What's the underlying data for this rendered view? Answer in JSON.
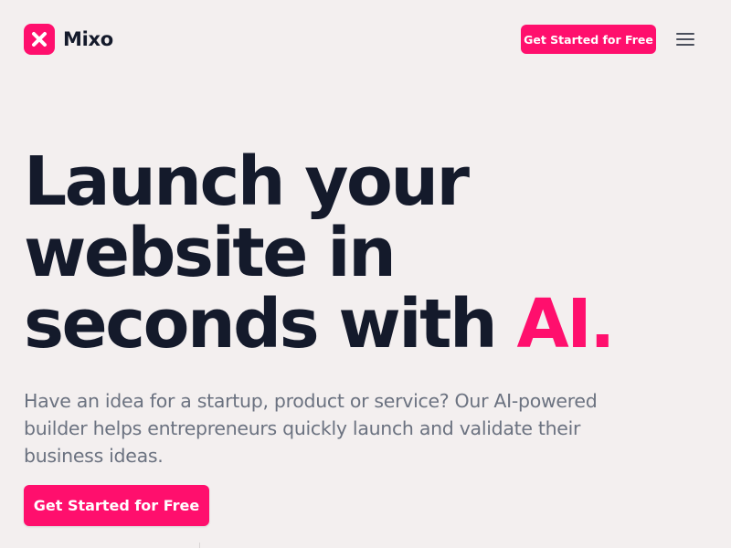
{
  "header": {
    "brand_name": "Mixo",
    "logo_icon": "close-x-icon",
    "cta_label": "Get Started for Free",
    "menu_icon": "hamburger-menu-icon"
  },
  "hero": {
    "title_line1": "Launch your",
    "title_line2": "website in",
    "title_line3": "seconds with ",
    "title_accent": "AI.",
    "description": "Have an idea for a startup, product or service? Our AI-powered builder helps entrepreneurs quickly launch and validate their business ideas.",
    "cta_label": "Get Started for Free"
  },
  "colors": {
    "brand": "#ff0f6d",
    "heading": "#141a2b",
    "body_text": "#6b7280",
    "background": "#f3efef"
  }
}
